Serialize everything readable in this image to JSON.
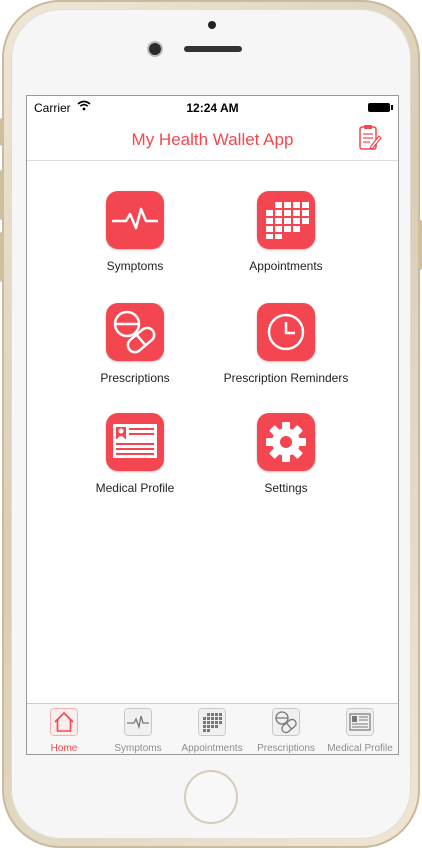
{
  "status": {
    "carrier": "Carrier",
    "time": "12:24 AM"
  },
  "navbar": {
    "title": "My Health Wallet App"
  },
  "menu": [
    {
      "label": "Symptoms",
      "icon": "pulse-icon"
    },
    {
      "label": "Appointments",
      "icon": "calendar-icon"
    },
    {
      "label": "Prescriptions",
      "icon": "pills-icon"
    },
    {
      "label": "Prescription Reminders",
      "icon": "clock-icon"
    },
    {
      "label": "Medical Profile",
      "icon": "id-card-icon"
    },
    {
      "label": "Settings",
      "icon": "gear-icon"
    }
  ],
  "tabs": [
    {
      "label": "Home",
      "icon": "home-icon",
      "active": true
    },
    {
      "label": "Symptoms",
      "icon": "pulse-icon",
      "active": false
    },
    {
      "label": "Appointments",
      "icon": "calendar-icon",
      "active": false
    },
    {
      "label": "Prescriptions",
      "icon": "pills-icon",
      "active": false
    },
    {
      "label": "Medical Profile",
      "icon": "id-card-icon",
      "active": false
    }
  ],
  "colors": {
    "accent": "#f1484d",
    "tile": "#f44650"
  }
}
